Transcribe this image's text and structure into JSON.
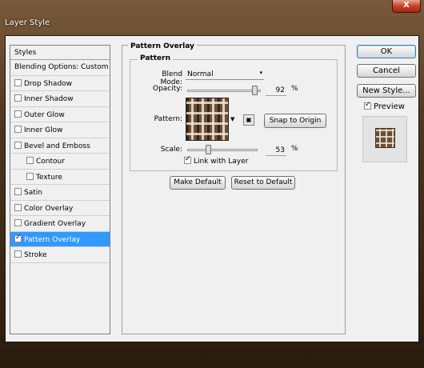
{
  "window": {
    "title": "Layer Style",
    "close_label": "X"
  },
  "styles": {
    "header": "Styles",
    "blending_options": "Blending Options: Custom",
    "items": [
      {
        "label": "Drop Shadow",
        "checked": false,
        "indent": false,
        "selected": false
      },
      {
        "label": "Inner Shadow",
        "checked": false,
        "indent": false,
        "selected": false
      },
      {
        "label": "Outer Glow",
        "checked": false,
        "indent": false,
        "selected": false
      },
      {
        "label": "Inner Glow",
        "checked": false,
        "indent": false,
        "selected": false
      },
      {
        "label": "Bevel and Emboss",
        "checked": false,
        "indent": false,
        "selected": false
      },
      {
        "label": "Contour",
        "checked": false,
        "indent": true,
        "selected": false
      },
      {
        "label": "Texture",
        "checked": false,
        "indent": true,
        "selected": false
      },
      {
        "label": "Satin",
        "checked": false,
        "indent": false,
        "selected": false
      },
      {
        "label": "Color Overlay",
        "checked": false,
        "indent": false,
        "selected": false
      },
      {
        "label": "Gradient Overlay",
        "checked": false,
        "indent": false,
        "selected": false
      },
      {
        "label": "Pattern Overlay",
        "checked": true,
        "indent": false,
        "selected": true
      },
      {
        "label": "Stroke",
        "checked": false,
        "indent": false,
        "selected": false
      }
    ]
  },
  "pattern_overlay": {
    "group_title": "Pattern Overlay",
    "subgroup_title": "Pattern",
    "blend_mode_label": "Blend Mode:",
    "blend_mode_value": "Normal",
    "opacity_label": "Opacity:",
    "opacity_value": "92",
    "opacity_unit": "%",
    "opacity_level": 0.92,
    "pattern_label": "Pattern:",
    "snap_to_origin": "Snap to Origin",
    "scale_label": "Scale:",
    "scale_value": "53",
    "scale_unit": "%",
    "scale_level": 0.53,
    "link_with_layer": "Link with Layer",
    "link_checked": true,
    "make_default": "Make Default",
    "reset_to_default": "Reset to Default"
  },
  "actions": {
    "ok": "OK",
    "cancel": "Cancel",
    "new_style": "New Style...",
    "preview": "Preview",
    "preview_checked": true
  },
  "colors": {
    "selection": "#3399ff",
    "pattern_brown": "#6b4e37",
    "pattern_cream": "#ebe4d7",
    "window_frame": "#4e3520"
  }
}
